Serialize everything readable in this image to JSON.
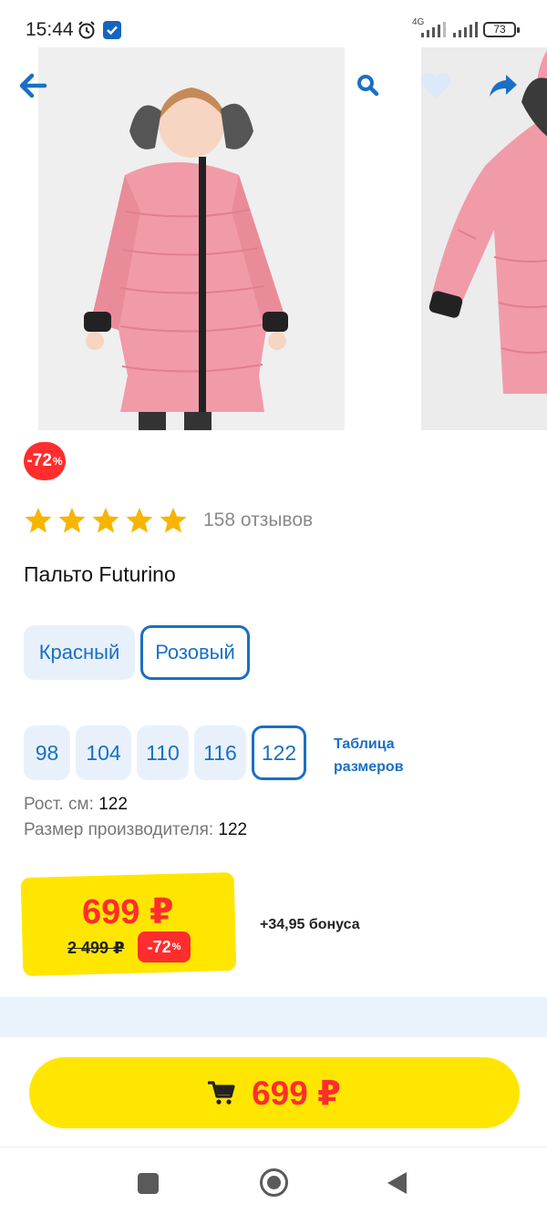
{
  "status_bar": {
    "time": "15:44",
    "network": "4G",
    "battery": "73"
  },
  "toolbar": {
    "back_icon": "arrow-left-icon",
    "search_icon": "search-icon",
    "favorite_icon": "heart-icon",
    "share_icon": "share-icon"
  },
  "product": {
    "discount_badge": "-72",
    "discount_badge_suffix": "%",
    "rating_stars": 5,
    "reviews": "158 отзывов",
    "title": "Пальто Futurino",
    "colors": [
      "Красный",
      "Розовый"
    ],
    "selected_color": "Розовый",
    "sizes": [
      "98",
      "104",
      "110",
      "116",
      "122"
    ],
    "selected_size": "122",
    "size_table_label": "Таблица размеров",
    "height_label": "Рост. см:",
    "height_value": "122",
    "maker_size_label": "Размер производителя:",
    "maker_size_value": "122"
  },
  "price": {
    "current": "699 ₽",
    "old": "2 499 ₽",
    "discount": "-72",
    "discount_suffix": "%",
    "bonus": "+34,95 бонуса"
  },
  "buy_button": {
    "price": "699 ₽",
    "icon": "cart-icon"
  },
  "colors": {
    "accent_blue": "#1a6fc4",
    "price_red": "#ff2d2d",
    "yellow": "#ffe600",
    "star": "#f7b500"
  }
}
